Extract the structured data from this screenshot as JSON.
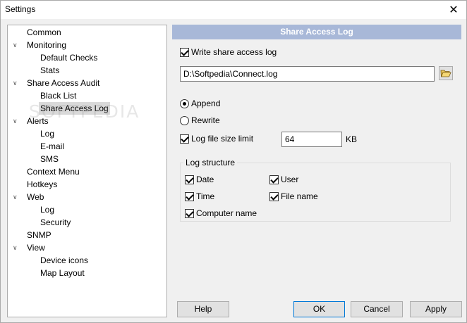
{
  "window": {
    "title": "Settings"
  },
  "tree": {
    "items": [
      {
        "label": "Common",
        "level": 1
      },
      {
        "label": "Monitoring",
        "level": 0,
        "expanded": true
      },
      {
        "label": "Default Checks",
        "level": 2
      },
      {
        "label": "Stats",
        "level": 2
      },
      {
        "label": "Share Access Audit",
        "level": 0,
        "expanded": true
      },
      {
        "label": "Black List",
        "level": 2
      },
      {
        "label": "Share Access Log",
        "level": 2,
        "selected": true
      },
      {
        "label": "Alerts",
        "level": 0,
        "expanded": true
      },
      {
        "label": "Log",
        "level": 2
      },
      {
        "label": "E-mail",
        "level": 2
      },
      {
        "label": "SMS",
        "level": 2
      },
      {
        "label": "Context Menu",
        "level": 1
      },
      {
        "label": "Hotkeys",
        "level": 1
      },
      {
        "label": "Web",
        "level": 0,
        "expanded": true
      },
      {
        "label": "Log",
        "level": 2
      },
      {
        "label": "Security",
        "level": 2
      },
      {
        "label": "SNMP",
        "level": 1
      },
      {
        "label": "View",
        "level": 0,
        "expanded": true
      },
      {
        "label": "Device icons",
        "level": 2
      },
      {
        "label": "Map Layout",
        "level": 2
      }
    ],
    "watermark": "SOFTPEDIA"
  },
  "panel": {
    "header": "Share Access Log",
    "write_log": {
      "label": "Write share access log",
      "checked": true
    },
    "log_path": "D:\\Softpedia\\Connect.log",
    "append": {
      "label": "Append",
      "checked": true
    },
    "rewrite": {
      "label": "Rewrite",
      "checked": false
    },
    "size_limit": {
      "label": "Log file size limit",
      "checked": true,
      "value": "64",
      "unit": "KB"
    },
    "structure": {
      "title": "Log structure",
      "date": {
        "label": "Date",
        "checked": true
      },
      "user": {
        "label": "User",
        "checked": true
      },
      "time": {
        "label": "Time",
        "checked": true
      },
      "file_name": {
        "label": "File name",
        "checked": true
      },
      "computer_name": {
        "label": "Computer name",
        "checked": true
      }
    }
  },
  "buttons": {
    "help": "Help",
    "ok": "OK",
    "cancel": "Cancel",
    "apply": "Apply"
  },
  "colors": {
    "panel_header_bg": "#a8b8d8",
    "selection_bg": "#d9d9d9",
    "default_button_border": "#0078d7"
  }
}
